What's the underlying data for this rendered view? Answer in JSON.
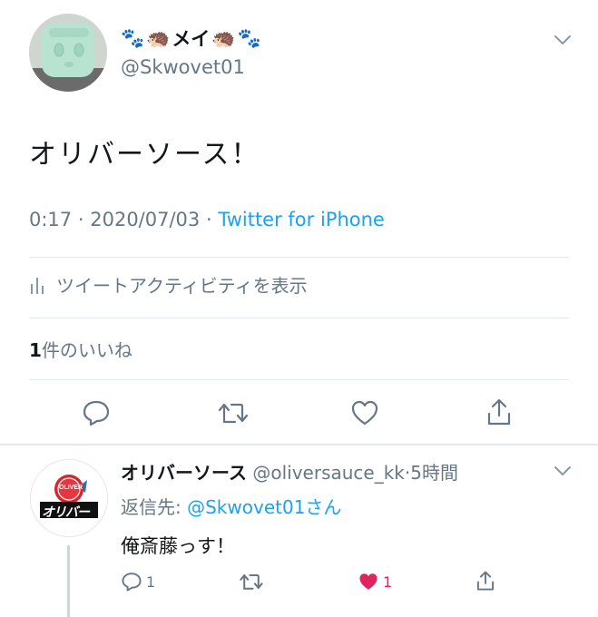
{
  "tweet": {
    "author": {
      "display_name_parts": [
        "🐾",
        "🦔",
        "メイ",
        "🦔",
        "🐾"
      ],
      "handle": "@Skwovet01",
      "avatar_icon": "stuffed-toy-avatar"
    },
    "text": "オリバーソース！",
    "meta": {
      "time": "0:17",
      "sep1": "·",
      "date": "2020/07/03",
      "sep2": "·",
      "source": "Twitter for iPhone"
    },
    "activity_label": "ツイートアクティビティを表示",
    "likes": {
      "count": "1",
      "label": "件のいいね"
    },
    "actions": [
      "reply-icon",
      "retweet-icon",
      "like-icon",
      "share-icon"
    ]
  },
  "reply": {
    "author": {
      "display_name": "オリバーソース",
      "handle": "@oliversauce_kk",
      "sep": "·",
      "time": "5時間",
      "logo_badge": "OLIVER",
      "logo_text": "オリバー"
    },
    "reply_to": {
      "prefix": "返信先:",
      "handle": "@Skwovet01",
      "suffix": "さん"
    },
    "text": "俺斎藤っす！",
    "counts": {
      "reply": "1",
      "like": "1"
    },
    "like_color": "#e0245e"
  },
  "colors": {
    "accent": "#1da1f2",
    "muted": "#657786",
    "divider": "#e1e8ed"
  }
}
